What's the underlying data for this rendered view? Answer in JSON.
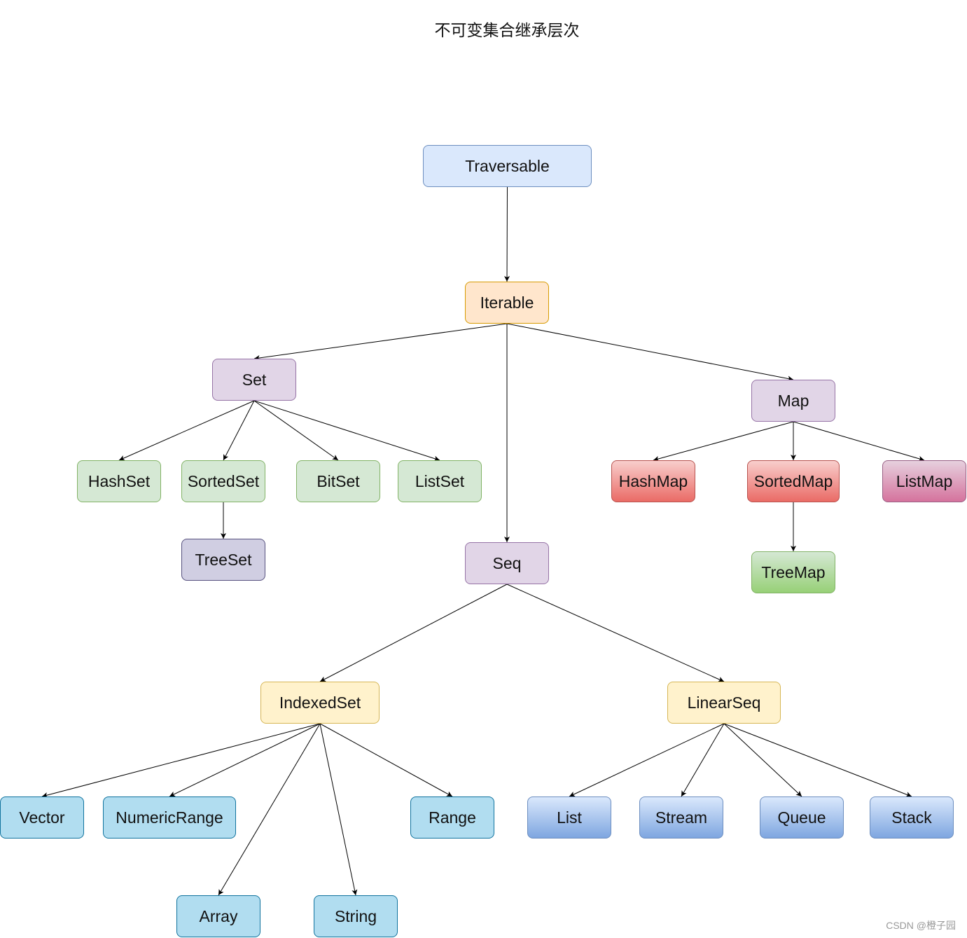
{
  "title": "不可变集合继承层次",
  "watermark": "CSDN @橙子园",
  "nodes": [
    {
      "id": "traversable",
      "label": "Traversable",
      "style": "blue-light"
    },
    {
      "id": "iterable",
      "label": "Iterable",
      "style": "orange"
    },
    {
      "id": "set",
      "label": "Set",
      "style": "purple"
    },
    {
      "id": "map",
      "label": "Map",
      "style": "purple"
    },
    {
      "id": "seq",
      "label": "Seq",
      "style": "purple"
    },
    {
      "id": "hashset",
      "label": "HashSet",
      "style": "green"
    },
    {
      "id": "sortedset",
      "label": "SortedSet",
      "style": "green"
    },
    {
      "id": "bitset",
      "label": "BitSet",
      "style": "green"
    },
    {
      "id": "listset",
      "label": "ListSet",
      "style": "green"
    },
    {
      "id": "treeset",
      "label": "TreeSet",
      "style": "slate"
    },
    {
      "id": "hashmap",
      "label": "HashMap",
      "style": "red"
    },
    {
      "id": "sortedmap",
      "label": "SortedMap",
      "style": "red"
    },
    {
      "id": "listmap",
      "label": "ListMap",
      "style": "pink"
    },
    {
      "id": "treemap",
      "label": "TreeMap",
      "style": "green-grad"
    },
    {
      "id": "indexedset",
      "label": "IndexedSet",
      "style": "yellow"
    },
    {
      "id": "linearseq",
      "label": "LinearSeq",
      "style": "yellow"
    },
    {
      "id": "vector",
      "label": "Vector",
      "style": "cyan"
    },
    {
      "id": "numericrange",
      "label": "NumericRange",
      "style": "cyan"
    },
    {
      "id": "range",
      "label": "Range",
      "style": "cyan"
    },
    {
      "id": "array",
      "label": "Array",
      "style": "cyan"
    },
    {
      "id": "string",
      "label": "String",
      "style": "cyan"
    },
    {
      "id": "list",
      "label": "List",
      "style": "blue-grad"
    },
    {
      "id": "stream",
      "label": "Stream",
      "style": "blue-grad"
    },
    {
      "id": "queue",
      "label": "Queue",
      "style": "blue-grad"
    },
    {
      "id": "stack",
      "label": "Stack",
      "style": "blue-grad"
    }
  ],
  "edges": [
    [
      "traversable",
      "iterable"
    ],
    [
      "iterable",
      "set"
    ],
    [
      "iterable",
      "seq"
    ],
    [
      "iterable",
      "map"
    ],
    [
      "set",
      "hashset"
    ],
    [
      "set",
      "sortedset"
    ],
    [
      "set",
      "bitset"
    ],
    [
      "set",
      "listset"
    ],
    [
      "sortedset",
      "treeset"
    ],
    [
      "map",
      "hashmap"
    ],
    [
      "map",
      "sortedmap"
    ],
    [
      "map",
      "listmap"
    ],
    [
      "sortedmap",
      "treemap"
    ],
    [
      "seq",
      "indexedset"
    ],
    [
      "seq",
      "linearseq"
    ],
    [
      "indexedset",
      "vector"
    ],
    [
      "indexedset",
      "numericrange"
    ],
    [
      "indexedset",
      "array"
    ],
    [
      "indexedset",
      "string"
    ],
    [
      "indexedset",
      "range"
    ],
    [
      "linearseq",
      "list"
    ],
    [
      "linearseq",
      "stream"
    ],
    [
      "linearseq",
      "queue"
    ],
    [
      "linearseq",
      "stack"
    ]
  ]
}
